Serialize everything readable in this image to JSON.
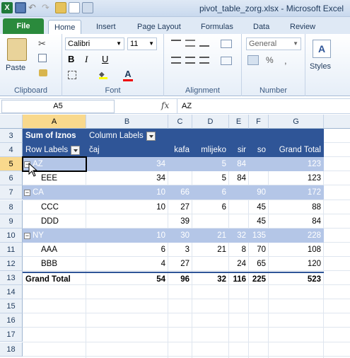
{
  "window": {
    "title": "pivot_table_zorg.xlsx  -  Microsoft Excel"
  },
  "ribbon": {
    "file_tab": "File",
    "tabs": [
      "Home",
      "Insert",
      "Page Layout",
      "Formulas",
      "Data",
      "Review"
    ],
    "active_tab": "Home",
    "paste_label": "Paste",
    "clipboard_label": "Clipboard",
    "font_name": "Calibri",
    "font_size": "11",
    "font_label": "Font",
    "alignment_label": "Alignment",
    "number_format": "General",
    "number_label": "Number",
    "styles_label": "Styles",
    "bold": "B",
    "italic": "I",
    "underline": "U"
  },
  "formula_bar": {
    "name_box": "A5",
    "fx": "fx",
    "value": "AZ"
  },
  "columns": [
    "A",
    "B",
    "C",
    "D",
    "E",
    "F",
    "G"
  ],
  "pivot": {
    "sum_label": "Sum of Iznos",
    "column_labels": "Column Labels",
    "row_labels": "Row Labels",
    "col_headers": [
      "čaj",
      "kafa",
      "mlijeko",
      "sir",
      "so",
      "Grand Total"
    ],
    "rows": [
      {
        "num": "5",
        "label": "AZ",
        "group": true,
        "v": [
          "34",
          "",
          "5",
          "84",
          "",
          "123"
        ]
      },
      {
        "num": "6",
        "label": "EEE",
        "group": false,
        "v": [
          "34",
          "",
          "5",
          "84",
          "",
          "123"
        ]
      },
      {
        "num": "7",
        "label": "CA",
        "group": true,
        "v": [
          "10",
          "66",
          "6",
          "",
          "90",
          "172"
        ]
      },
      {
        "num": "8",
        "label": "CCC",
        "group": false,
        "v": [
          "10",
          "27",
          "6",
          "",
          "45",
          "88"
        ]
      },
      {
        "num": "9",
        "label": "DDD",
        "group": false,
        "v": [
          "",
          "39",
          "",
          "",
          "45",
          "84"
        ]
      },
      {
        "num": "10",
        "label": "NY",
        "group": true,
        "v": [
          "10",
          "30",
          "21",
          "32",
          "135",
          "228"
        ]
      },
      {
        "num": "11",
        "label": "AAA",
        "group": false,
        "v": [
          "6",
          "3",
          "21",
          "8",
          "70",
          "108"
        ]
      },
      {
        "num": "12",
        "label": "BBB",
        "group": false,
        "v": [
          "4",
          "27",
          "",
          "24",
          "65",
          "120"
        ]
      }
    ],
    "grand_total": {
      "num": "13",
      "label": "Grand Total",
      "v": [
        "54",
        "96",
        "32",
        "116",
        "225",
        "523"
      ]
    }
  },
  "row_numbers": [
    "3",
    "4",
    "5",
    "6",
    "7",
    "8",
    "9",
    "10",
    "11",
    "12",
    "13",
    "14",
    "15",
    "16",
    "17",
    "18"
  ],
  "colors": {
    "header_blue": "#2f5597",
    "band_blue": "#b4c6e7",
    "file_green": "#2a8a3c",
    "selection": "#f9d98d"
  }
}
